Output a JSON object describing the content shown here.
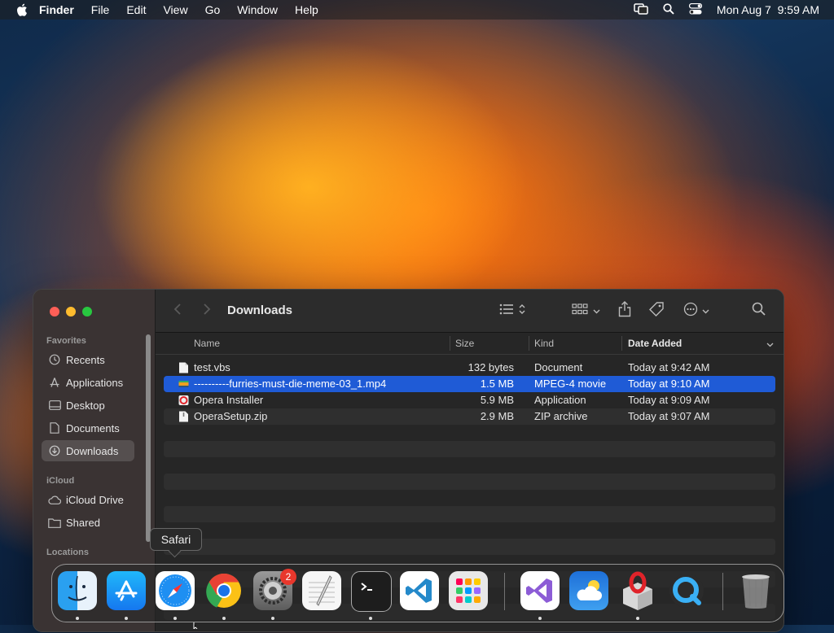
{
  "menubar": {
    "app_name": "Finder",
    "items": [
      "File",
      "Edit",
      "View",
      "Go",
      "Window",
      "Help"
    ],
    "clock": "Mon Aug 7  9:59 AM"
  },
  "window": {
    "title": "Downloads",
    "sidebar": {
      "favorites_header": "Favorites",
      "favorites": [
        "Recents",
        "Applications",
        "Desktop",
        "Documents",
        "Downloads"
      ],
      "selected": "Downloads",
      "icloud_header": "iCloud",
      "icloud": [
        "iCloud Drive",
        "Shared"
      ],
      "locations_header": "Locations"
    },
    "columns": {
      "name": "Name",
      "size": "Size",
      "kind": "Kind",
      "date": "Date Added"
    },
    "files": [
      {
        "name": "test.vbs",
        "size": "132 bytes",
        "kind": "Document",
        "date": "Today at 9:42 AM",
        "icon": "document-icon"
      },
      {
        "name": "----------furries-must-die-meme-03_1.mp4",
        "size": "1.5 MB",
        "kind": "MPEG-4 movie",
        "date": "Today at 9:10 AM",
        "icon": "movie-icon"
      },
      {
        "name": "Opera Installer",
        "size": "5.9 MB",
        "kind": "Application",
        "date": "Today at 9:09 AM",
        "icon": "opera-installer-icon"
      },
      {
        "name": "OperaSetup.zip",
        "size": "2.9 MB",
        "kind": "ZIP archive",
        "date": "Today at 9:07 AM",
        "icon": "zip-icon"
      }
    ],
    "selected_file_index": 1
  },
  "tooltip": {
    "label": "Safari"
  },
  "dock": {
    "apps": [
      "Finder",
      "App Store",
      "Safari",
      "Google Chrome",
      "System Settings",
      "TextEdit",
      "Terminal",
      "Visual Studio Code",
      "Launchpad",
      "Visual Studio",
      "Weather",
      "Opera Installer",
      "QuickTime Player",
      "Trash"
    ],
    "settings_badge": "2"
  },
  "colors": {
    "accent": "#1f5bd6",
    "badge": "#e8372c"
  }
}
